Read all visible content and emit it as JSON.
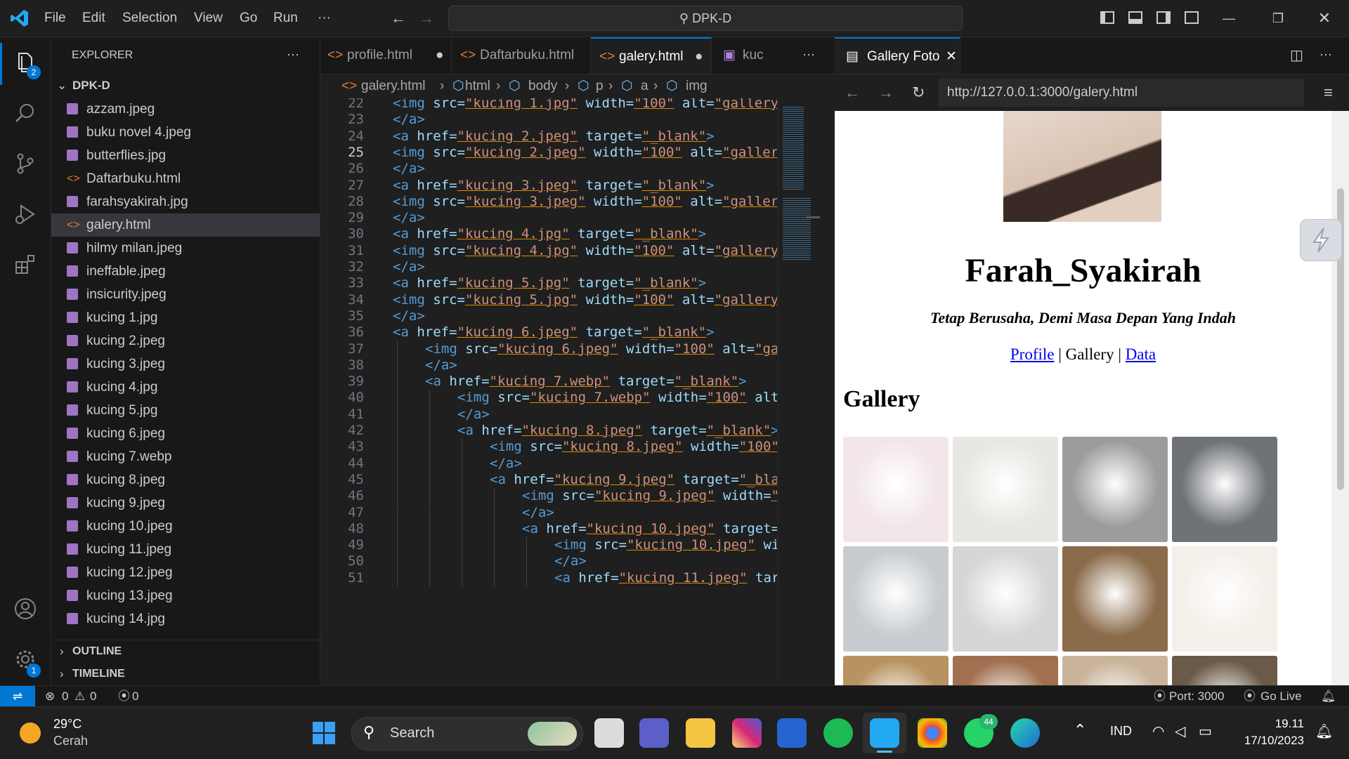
{
  "titlebar": {
    "menu": [
      "File",
      "Edit",
      "Selection",
      "View",
      "Go",
      "Run",
      "···"
    ],
    "command_center": "DPK-D"
  },
  "activity": {
    "explorer_badge": "2",
    "settings_badge": "1"
  },
  "sidebar": {
    "title": "EXPLORER",
    "folder": "DPK-D",
    "files": [
      "azzam.jpeg",
      "buku novel 4.jpeg",
      "butterflies.jpg",
      "Daftarbuku.html",
      "farahsyakirah.jpg",
      "galery.html",
      "hilmy milan.jpeg",
      "ineffable.jpeg",
      "insicurity.jpeg",
      "kucing 1.jpg",
      "kucing 2.jpeg",
      "kucing 3.jpeg",
      "kucing 4.jpg",
      "kucing 5.jpg",
      "kucing 6.jpeg",
      "kucing 7.webp",
      "kucing 8.jpeg",
      "kucing 9.jpeg",
      "kucing 10.jpeg",
      "kucing 11.jpeg",
      "kucing 12.jpeg",
      "kucing 13.jpeg",
      "kucing 14.jpg"
    ],
    "outline": "OUTLINE",
    "timeline": "TIMELINE"
  },
  "editor": {
    "tabs": [
      "profile.html",
      "Daftarbuku.html",
      "galery.html",
      "kuc"
    ],
    "breadcrumb": [
      "galery.html",
      "html",
      "body",
      "p",
      "a",
      "img"
    ],
    "lines": [
      {
        "n": "22",
        "i": 0,
        "t": [
          [
            "<img ",
            "tg"
          ],
          [
            "src=",
            "at"
          ],
          [
            "\"kucing 1.jpg\"",
            "st"
          ],
          [
            " width=",
            "at"
          ],
          [
            "\"100\"",
            "st"
          ],
          [
            " alt=",
            "at"
          ],
          [
            "\"gallery",
            "st"
          ]
        ]
      },
      {
        "n": "23",
        "i": 0,
        "t": [
          [
            "</a>",
            "tg"
          ]
        ]
      },
      {
        "n": "24",
        "i": 0,
        "t": [
          [
            "<a ",
            "tg"
          ],
          [
            "href=",
            "at"
          ],
          [
            "\"kucing 2.jpeg\"",
            "st"
          ],
          [
            " target=",
            "at"
          ],
          [
            "\"_blank\"",
            "st"
          ],
          [
            ">",
            "tg"
          ]
        ]
      },
      {
        "n": "25",
        "i": 0,
        "t": [
          [
            "<img ",
            "tg"
          ],
          [
            "src=",
            "at"
          ],
          [
            "\"kucing 2.jpeg\"",
            "st"
          ],
          [
            " width=",
            "at"
          ],
          [
            "\"100\"",
            "st"
          ],
          [
            " alt=",
            "at"
          ],
          [
            "\"galler",
            "st"
          ]
        ]
      },
      {
        "n": "26",
        "i": 0,
        "t": [
          [
            "</a>",
            "tg"
          ]
        ]
      },
      {
        "n": "27",
        "i": 0,
        "t": [
          [
            "<a ",
            "tg"
          ],
          [
            "href=",
            "at"
          ],
          [
            "\"kucing 3.jpeg\"",
            "st"
          ],
          [
            " target=",
            "at"
          ],
          [
            "\"_blank\"",
            "st"
          ],
          [
            ">",
            "tg"
          ]
        ]
      },
      {
        "n": "28",
        "i": 0,
        "t": [
          [
            "<img ",
            "tg"
          ],
          [
            "src=",
            "at"
          ],
          [
            "\"kucing 3.jpeg\"",
            "st"
          ],
          [
            " width=",
            "at"
          ],
          [
            "\"100\"",
            "st"
          ],
          [
            " alt=",
            "at"
          ],
          [
            "\"galler",
            "st"
          ]
        ]
      },
      {
        "n": "29",
        "i": 0,
        "t": [
          [
            "</a>",
            "tg"
          ]
        ]
      },
      {
        "n": "30",
        "i": 0,
        "t": [
          [
            "<a ",
            "tg"
          ],
          [
            "href=",
            "at"
          ],
          [
            "\"kucing 4.jpg\"",
            "st"
          ],
          [
            " target=",
            "at"
          ],
          [
            "\"_blank\"",
            "st"
          ],
          [
            ">",
            "tg"
          ]
        ]
      },
      {
        "n": "31",
        "i": 0,
        "t": [
          [
            "<img ",
            "tg"
          ],
          [
            "src=",
            "at"
          ],
          [
            "\"kucing 4.jpg\"",
            "st"
          ],
          [
            " width=",
            "at"
          ],
          [
            "\"100\"",
            "st"
          ],
          [
            " alt=",
            "at"
          ],
          [
            "\"gallery",
            "st"
          ]
        ]
      },
      {
        "n": "32",
        "i": 0,
        "t": [
          [
            "</a>",
            "tg"
          ]
        ]
      },
      {
        "n": "33",
        "i": 0,
        "t": [
          [
            "<a ",
            "tg"
          ],
          [
            "href=",
            "at"
          ],
          [
            "\"kucing 5.jpg\"",
            "st"
          ],
          [
            " target=",
            "at"
          ],
          [
            "\"_blank\"",
            "st"
          ],
          [
            ">",
            "tg"
          ]
        ]
      },
      {
        "n": "34",
        "i": 0,
        "t": [
          [
            "<img ",
            "tg"
          ],
          [
            "src=",
            "at"
          ],
          [
            "\"kucing 5.jpg\"",
            "st"
          ],
          [
            " width=",
            "at"
          ],
          [
            "\"100\"",
            "st"
          ],
          [
            " alt=",
            "at"
          ],
          [
            "\"gallery",
            "st"
          ]
        ]
      },
      {
        "n": "35",
        "i": 0,
        "t": [
          [
            "</a>",
            "tg"
          ]
        ]
      },
      {
        "n": "36",
        "i": 0,
        "t": [
          [
            "<a ",
            "tg"
          ],
          [
            "href=",
            "at"
          ],
          [
            "\"kucing 6.jpeg\"",
            "st"
          ],
          [
            " target=",
            "at"
          ],
          [
            "\"_blank\"",
            "st"
          ],
          [
            ">",
            "tg"
          ]
        ]
      },
      {
        "n": "37",
        "i": 1,
        "t": [
          [
            "<img ",
            "tg"
          ],
          [
            "src=",
            "at"
          ],
          [
            "\"kucing 6.jpeg\"",
            "st"
          ],
          [
            " width=",
            "at"
          ],
          [
            "\"100\"",
            "st"
          ],
          [
            " alt=",
            "at"
          ],
          [
            "\"ga",
            "st"
          ]
        ]
      },
      {
        "n": "38",
        "i": 1,
        "t": [
          [
            "</a>",
            "tg"
          ]
        ]
      },
      {
        "n": "39",
        "i": 1,
        "t": [
          [
            "<a ",
            "tg"
          ],
          [
            "href=",
            "at"
          ],
          [
            "\"kucing 7.webp\"",
            "st"
          ],
          [
            " target=",
            "at"
          ],
          [
            "\"_blank\"",
            "st"
          ],
          [
            ">",
            "tg"
          ]
        ]
      },
      {
        "n": "40",
        "i": 2,
        "t": [
          [
            "<img ",
            "tg"
          ],
          [
            "src=",
            "at"
          ],
          [
            "\"kucing 7.webp\"",
            "st"
          ],
          [
            " width=",
            "at"
          ],
          [
            "\"100\"",
            "st"
          ],
          [
            " alt",
            "at"
          ]
        ]
      },
      {
        "n": "41",
        "i": 2,
        "t": [
          [
            "</a>",
            "tg"
          ]
        ]
      },
      {
        "n": "42",
        "i": 2,
        "t": [
          [
            "<a ",
            "tg"
          ],
          [
            "href=",
            "at"
          ],
          [
            "\"kucing 8.jpeg\"",
            "st"
          ],
          [
            " target=",
            "at"
          ],
          [
            "\"_blank\"",
            "st"
          ],
          [
            ">",
            "tg"
          ]
        ]
      },
      {
        "n": "43",
        "i": 3,
        "t": [
          [
            "<img ",
            "tg"
          ],
          [
            "src=",
            "at"
          ],
          [
            "\"kucing 8.jpeg\"",
            "st"
          ],
          [
            " width=",
            "at"
          ],
          [
            "\"100\"",
            "st"
          ]
        ]
      },
      {
        "n": "44",
        "i": 3,
        "t": [
          [
            "</a>",
            "tg"
          ]
        ]
      },
      {
        "n": "45",
        "i": 3,
        "t": [
          [
            "<a ",
            "tg"
          ],
          [
            "href=",
            "at"
          ],
          [
            "\"kucing 9.jpeg\"",
            "st"
          ],
          [
            " target=",
            "at"
          ],
          [
            "\"_bla",
            "st"
          ]
        ]
      },
      {
        "n": "46",
        "i": 4,
        "t": [
          [
            "<img ",
            "tg"
          ],
          [
            "src=",
            "at"
          ],
          [
            "\"kucing 9.jpeg\"",
            "st"
          ],
          [
            " width=",
            "at"
          ],
          [
            "\"",
            "st"
          ]
        ]
      },
      {
        "n": "47",
        "i": 4,
        "t": [
          [
            "</a>",
            "tg"
          ]
        ]
      },
      {
        "n": "48",
        "i": 4,
        "t": [
          [
            "<a ",
            "tg"
          ],
          [
            "href=",
            "at"
          ],
          [
            "\"kucing 10.jpeg\"",
            "st"
          ],
          [
            " target=",
            "at"
          ]
        ]
      },
      {
        "n": "49",
        "i": 5,
        "t": [
          [
            "<img ",
            "tg"
          ],
          [
            "src=",
            "at"
          ],
          [
            "\"kucing 10.jpeg\"",
            "st"
          ],
          [
            " wi",
            "at"
          ]
        ]
      },
      {
        "n": "50",
        "i": 5,
        "t": [
          [
            "</a>",
            "tg"
          ]
        ]
      },
      {
        "n": "51",
        "i": 5,
        "t": [
          [
            "<a ",
            "tg"
          ],
          [
            "href=",
            "at"
          ],
          [
            "\"kucing 11.jpeg\"",
            "st"
          ],
          [
            " tar",
            "at"
          ]
        ]
      }
    ],
    "current_line": "25"
  },
  "preview": {
    "tab_title": "Gallery Foto",
    "url": "http://127.0.0.1:3000/galery.html",
    "name": "Farah_Syakirah",
    "motto": "Tetap Berusaha, Demi Masa Depan Yang Indah",
    "nav": {
      "profile": "Profile",
      "sep1": " | ",
      "gallery": "Gallery",
      "sep2": " | ",
      "data": "Data"
    },
    "heading": "Gallery",
    "thumb_colors": [
      "#f2e6e8",
      "#e9e7e3",
      "#9c9c9c",
      "#6f7378",
      "#c8ccd0",
      "#d6d6d6",
      "#8a6b4a",
      "#f4efe9",
      "#b89260",
      "#a07050",
      "#c9b39a",
      "#6b5a48"
    ]
  },
  "statusbar": {
    "errors": "0",
    "warnings": "0",
    "ports": "0",
    "port": "Port: 3000",
    "golive": "Go Live"
  },
  "taskbar": {
    "weather_temp": "29°C",
    "weather_desc": "Cerah",
    "search": "Search",
    "whatsapp_badge": "44",
    "lang": "IND",
    "time": "19.11",
    "date": "17/10/2023",
    "apps": [
      "windows-start",
      "search",
      "task-view",
      "teams",
      "file-explorer",
      "instagram",
      "todo",
      "spotify",
      "vscode",
      "chrome",
      "whatsapp",
      "edge"
    ]
  }
}
